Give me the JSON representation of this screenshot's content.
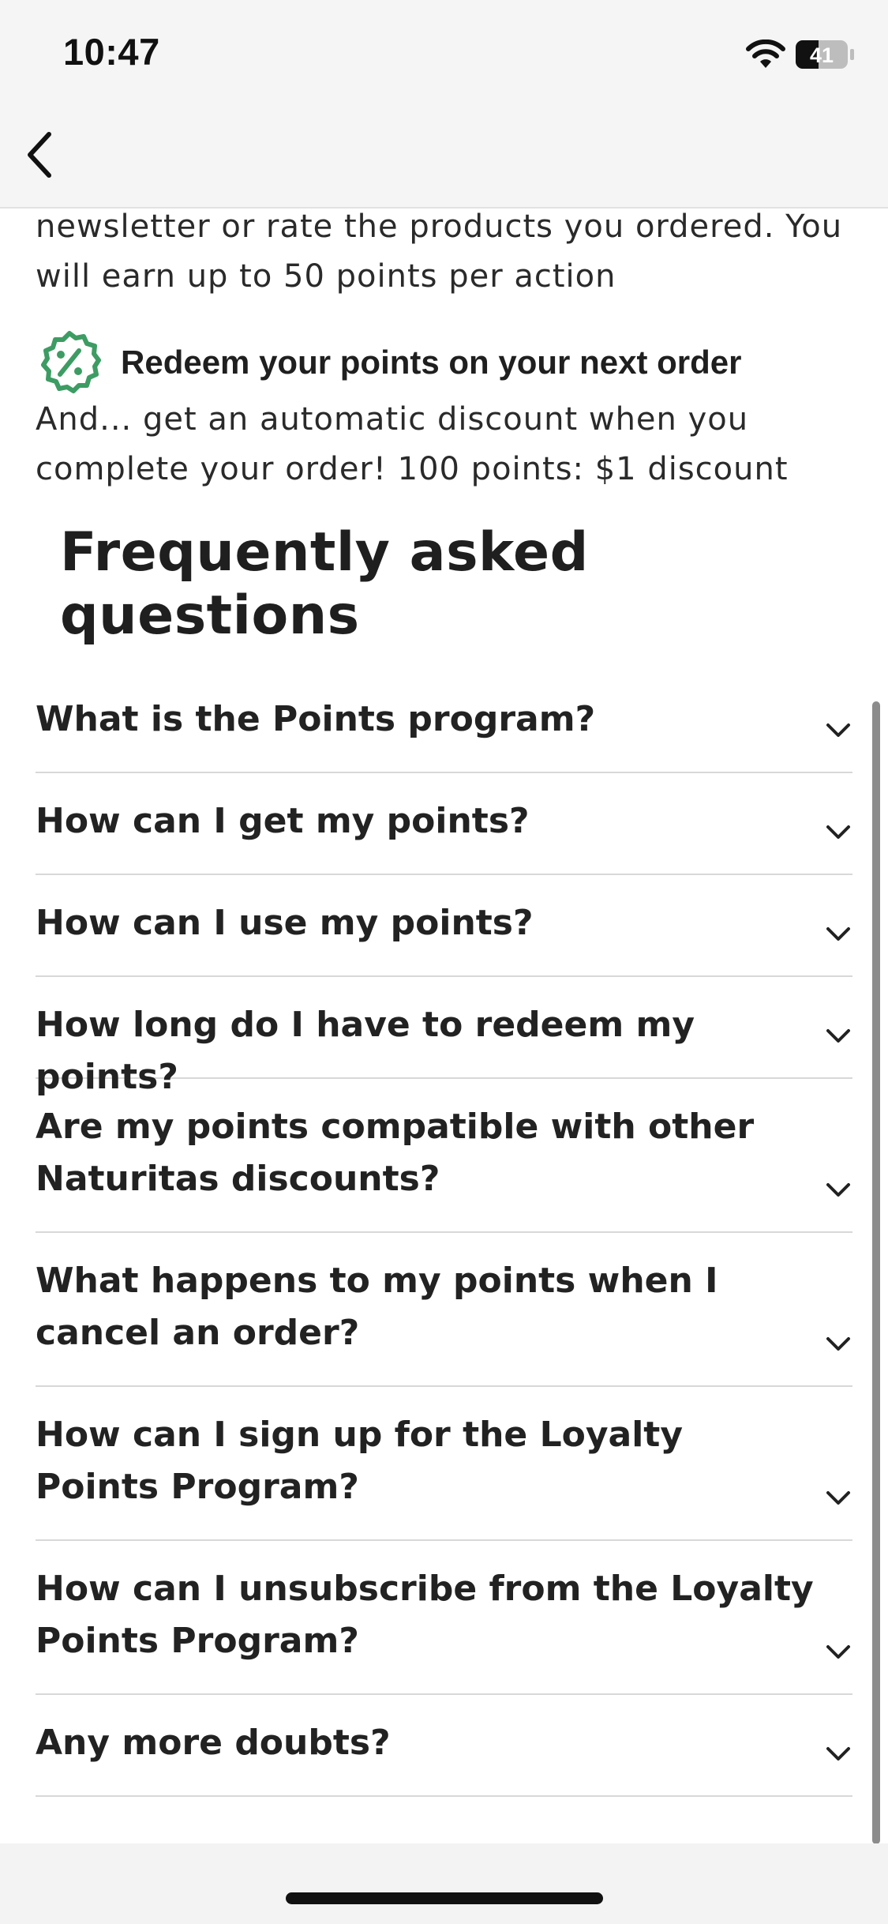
{
  "status_bar": {
    "time": "10:47",
    "battery_level": "41",
    "icons": [
      "wifi-icon",
      "battery-icon"
    ]
  },
  "header": {
    "back_icon": "chevron-left-icon"
  },
  "intro": {
    "text": "newsletter or rate the products you ordered. You will earn up to 50 points per action"
  },
  "redeem": {
    "icon": "percent-badge-icon",
    "heading": "Redeem your points on your next order",
    "text": "And... get an automatic discount when you complete your order! 100 points: $1 discount"
  },
  "faq": {
    "title": "Frequently asked questions",
    "items": [
      {
        "question": "What is the Points program?"
      },
      {
        "question": "How can I get my points?"
      },
      {
        "question": "How can I use my points?"
      },
      {
        "question": "How long do I have to redeem my points?"
      },
      {
        "question": "Are my points compatible with other Naturitas discounts?"
      },
      {
        "question": "What happens to my points when I cancel an order?"
      },
      {
        "question": "How can I sign up for the Loyalty Points Program?"
      },
      {
        "question": "How can I unsubscribe from the Loyalty Points Program?"
      },
      {
        "question": "Any more doubts?"
      }
    ],
    "chevron_icon": "chevron-down-icon"
  },
  "colors": {
    "accent_green": "#3d9c63",
    "text": "#1f1f1f",
    "divider": "#d8d8d8",
    "header_bg": "#f5f5f5"
  }
}
